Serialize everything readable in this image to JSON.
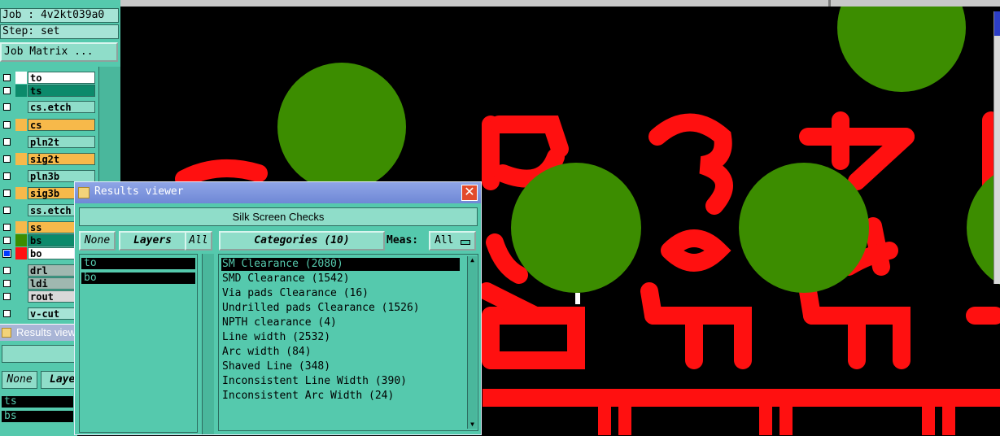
{
  "left_panel": {
    "job_label": "Job : 4v2kt039a0",
    "step_label": "Step: set",
    "job_matrix_button": "Job Matrix ...",
    "layers": [
      {
        "name": "to",
        "color": "#ffffff",
        "name_bg": "#ffffff",
        "selected": false
      },
      {
        "name": "ts",
        "color": "#0c8a6b",
        "name_bg": "#0c8a6b",
        "selected": false
      },
      {
        "name": "cs.etch",
        "color": "#55c9ad",
        "name_bg": "#8fddc9",
        "selected": false
      },
      {
        "name": "cs",
        "color": "#f7b94a",
        "name_bg": "#f7b94a",
        "selected": false
      },
      {
        "name": "pln2t",
        "color": "#55c9ad",
        "name_bg": "#8fddc9",
        "selected": false
      },
      {
        "name": "sig2t",
        "color": "#f7b94a",
        "name_bg": "#f7b94a",
        "selected": false
      },
      {
        "name": "pln3b",
        "color": "#55c9ad",
        "name_bg": "#8fddc9",
        "selected": false
      },
      {
        "name": "sig3b",
        "color": "#f7b94a",
        "name_bg": "#f7b94a",
        "selected": false
      },
      {
        "name": "ss.etch",
        "color": "#55c9ad",
        "name_bg": "#8fddc9",
        "selected": false
      },
      {
        "name": "ss",
        "color": "#f7b94a",
        "name_bg": "#f7b94a",
        "selected": false
      },
      {
        "name": "bs",
        "color": "#3c8d00",
        "name_bg": "#0c8a6b",
        "selected": false
      },
      {
        "name": "bo",
        "color": "#ff1010",
        "name_bg": "#ffffff",
        "selected": true
      },
      {
        "name": "drl",
        "color": "#55c9ad",
        "name_bg": "#a0b8b0",
        "selected": false
      },
      {
        "name": "ldi",
        "color": "#55c9ad",
        "name_bg": "#a0b8b0",
        "selected": false
      },
      {
        "name": "rout",
        "color": "#55c9ad",
        "name_bg": "#d8d8d8",
        "selected": false
      },
      {
        "name": "v-cut",
        "color": "#55c9ad",
        "name_bg": "#a6e4d6",
        "selected": false
      }
    ]
  },
  "results_viewer_back": {
    "title": "Results viewer",
    "none_button": "None",
    "layers_button": "Layers",
    "layer_items": [
      "ts",
      "bs"
    ]
  },
  "results_viewer": {
    "title": "Results viewer",
    "close_icon": "✕",
    "header": "Silk Screen Checks",
    "none_button": "None",
    "layers_button": "Layers",
    "all_button": "All",
    "categories_button": "Categories (10)",
    "meas_label": "Meas:",
    "meas_value": "All",
    "layer_items": [
      "to",
      "bo"
    ],
    "categories": [
      "SM Clearance (2080)",
      "SMD Clearance (1542)",
      "Via pads Clearance (16)",
      "Undrilled pads Clearance (1526)",
      "NPTH clearance (4)",
      "Line width (2532)",
      "Arc width (84)",
      "Shaved Line (348)",
      "Inconsistent Line Width (390)",
      "Inconsistent Arc Width (24)"
    ],
    "selected_category": "SM Clearance (2080)"
  },
  "colors": {
    "pad_green": "#3c8d00",
    "silk_red": "#ff1010",
    "panel_teal": "#55c9ad",
    "title_blue": "#7b93de"
  }
}
